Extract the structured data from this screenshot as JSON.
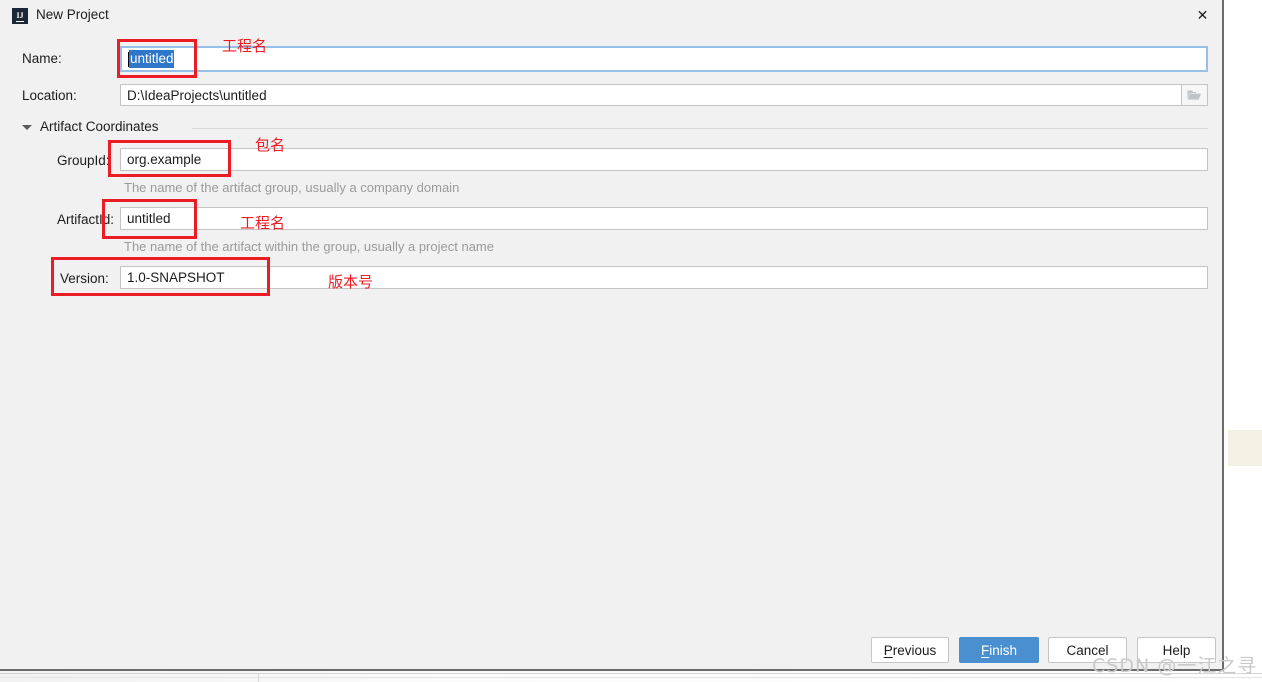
{
  "window": {
    "title": "New Project",
    "app_icon": "intellij-idea-icon",
    "icon_text": "IJ",
    "close_label": "✕"
  },
  "form": {
    "name": {
      "label": "Name:",
      "value": "untitled",
      "selected": true
    },
    "location": {
      "label": "Location:",
      "value": "D:\\IdeaProjects\\untitled",
      "browse_icon": "folder-icon"
    }
  },
  "section": {
    "title": "Artifact Coordinates",
    "expanded_icon": "chevron-down-icon"
  },
  "coordinates": [
    {
      "key": "group-id",
      "label": "GroupId:",
      "value": "org.example",
      "hint": "The name of the artifact group, usually a company domain"
    },
    {
      "key": "artifact-id",
      "label": "ArtifactId:",
      "value": "untitled",
      "hint": "The name of the artifact within the group, usually a project name"
    },
    {
      "key": "version",
      "label": "Version:",
      "value": "1.0-SNAPSHOT",
      "hint": ""
    }
  ],
  "annotations": [
    {
      "key": "name",
      "text": "工程名"
    },
    {
      "key": "group-id",
      "text": "包名"
    },
    {
      "key": "artifact-id",
      "text": "工程名"
    },
    {
      "key": "version",
      "text": "版本号"
    }
  ],
  "buttons": {
    "previous": {
      "label": "Previous",
      "mnemonic": "P"
    },
    "finish": {
      "label": "Finish",
      "mnemonic": "F",
      "primary": true
    },
    "cancel": {
      "label": "Cancel"
    },
    "help": {
      "label": "Help"
    }
  },
  "watermark": "CSDN @一江之寻",
  "colors": {
    "accent": "#4a90d0",
    "annotation": "#ec1c24",
    "selection": "#2f78c9",
    "dialog_bg": "#f1f1f1",
    "hint_text": "#9a9a9a"
  }
}
